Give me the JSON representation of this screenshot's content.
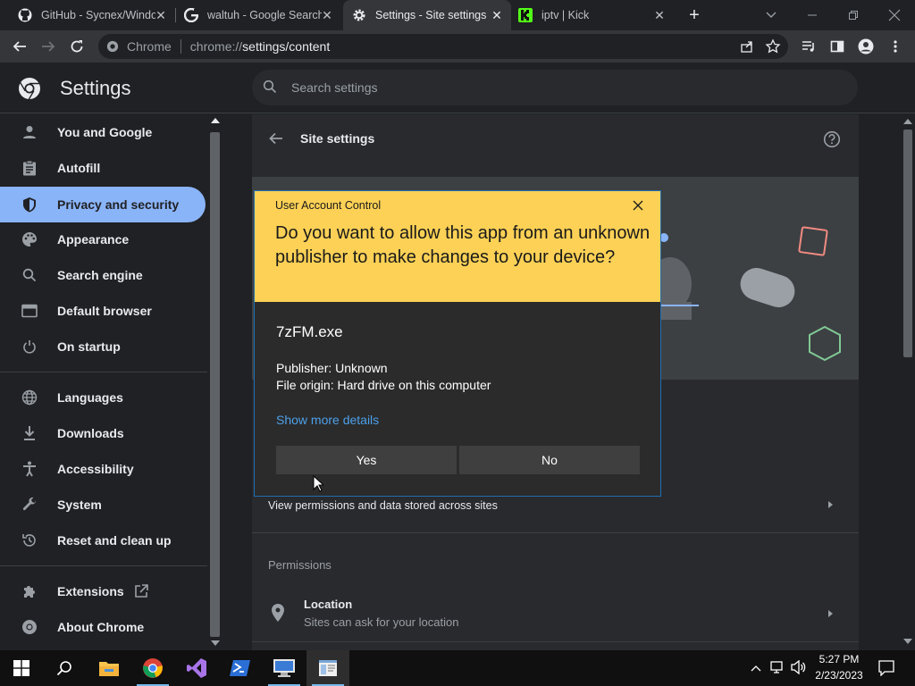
{
  "tabs": [
    {
      "title": "GitHub - Sycnex/Windo",
      "icon": "github-icon"
    },
    {
      "title": "waltuh - Google Search",
      "icon": "google-icon"
    },
    {
      "title": "Settings - Site settings",
      "icon": "settings-gear-icon"
    },
    {
      "title": "iptv | Kick",
      "icon": "kick-icon"
    }
  ],
  "omnibox": {
    "chip": "Chrome",
    "url_scheme": "chrome://",
    "url_path": "settings/content"
  },
  "settings": {
    "title": "Settings",
    "search_placeholder": "Search settings"
  },
  "sidebar": {
    "items": [
      {
        "label": "You and Google",
        "icon": "person-icon"
      },
      {
        "label": "Autofill",
        "icon": "clipboard-icon"
      },
      {
        "label": "Privacy and security",
        "icon": "shield-icon"
      },
      {
        "label": "Appearance",
        "icon": "palette-icon"
      },
      {
        "label": "Search engine",
        "icon": "search-icon"
      },
      {
        "label": "Default browser",
        "icon": "browser-icon"
      },
      {
        "label": "On startup",
        "icon": "power-icon"
      },
      {
        "label": "Languages",
        "icon": "globe-icon"
      },
      {
        "label": "Downloads",
        "icon": "download-icon"
      },
      {
        "label": "Accessibility",
        "icon": "accessibility-icon"
      },
      {
        "label": "System",
        "icon": "wrench-icon"
      },
      {
        "label": "Reset and clean up",
        "icon": "reset-icon"
      },
      {
        "label": "Extensions",
        "icon": "puzzle-icon"
      },
      {
        "label": "About Chrome",
        "icon": "chrome-icon"
      }
    ],
    "selected": "Privacy and security"
  },
  "content": {
    "header_title": "Site settings",
    "view_permissions": "View permissions and data stored across sites",
    "permissions_heading": "Permissions",
    "location_title": "Location",
    "location_sub": "Sites can ask for your location"
  },
  "uac": {
    "window_title": "User Account Control",
    "question": "Do you want to allow this app from an unknown publisher to make changes to your device?",
    "app_name": "7zFM.exe",
    "publisher": "Publisher: Unknown",
    "origin": "File origin: Hard drive on this computer",
    "more_details": "Show more details",
    "yes": "Yes",
    "no": "No"
  },
  "taskbar": {
    "time": "5:27 PM",
    "date": "2/23/2023",
    "apps": [
      "start-icon",
      "search-icon",
      "file-explorer-icon",
      "chrome-icon",
      "visual-studio-icon",
      "powershell-icon",
      "remote-desktop-icon",
      "app-window-icon"
    ]
  },
  "colors": {
    "uac_banner": "#fcd156",
    "selected_nav": "#8ab4f8",
    "link": "#4ca0ea"
  }
}
